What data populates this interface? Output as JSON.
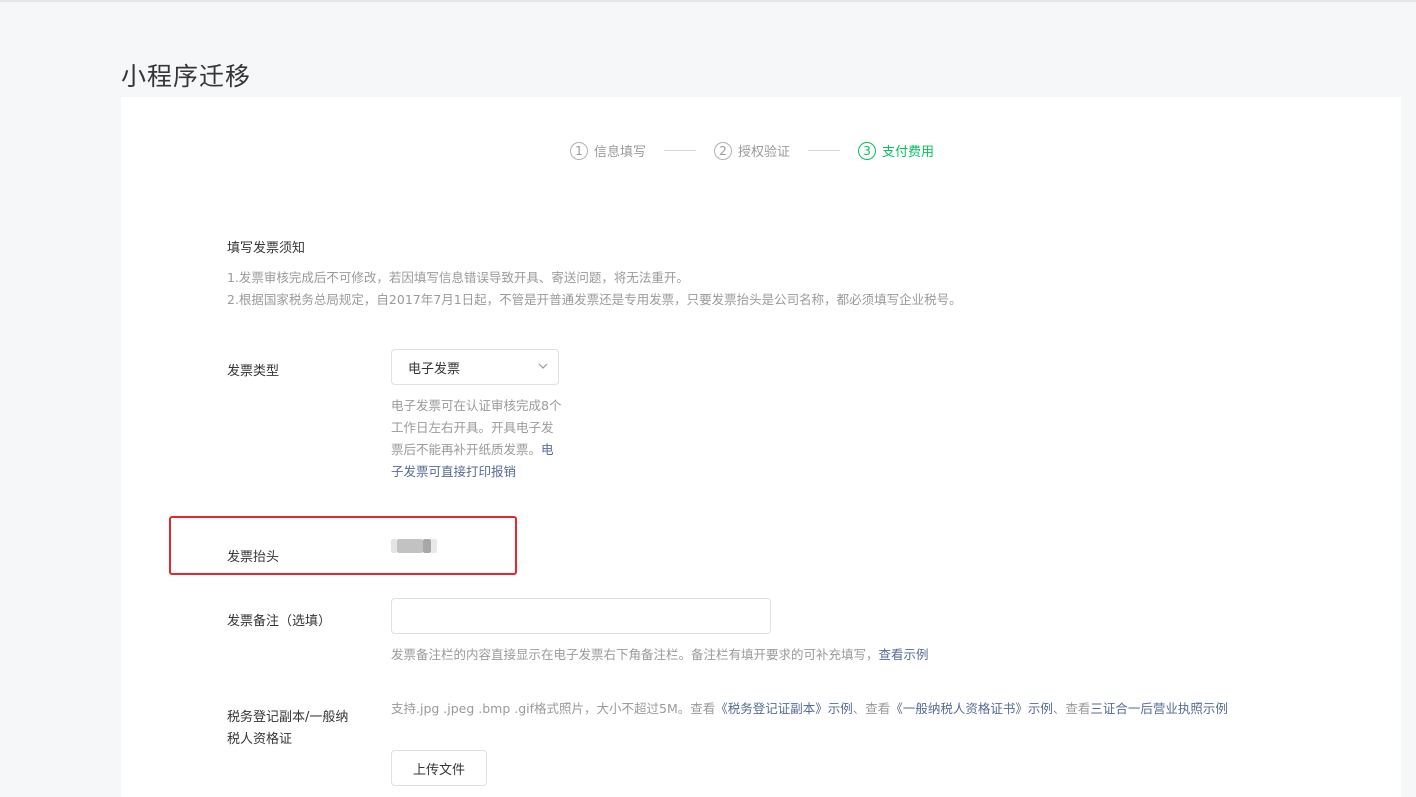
{
  "page": {
    "title": "小程序迁移"
  },
  "steps": [
    {
      "num": "1",
      "label": "信息填写",
      "active": false
    },
    {
      "num": "2",
      "label": "授权验证",
      "active": false
    },
    {
      "num": "3",
      "label": "支付费用",
      "active": true
    }
  ],
  "notice": {
    "title": "填写发票须知",
    "line1": "1.发票审核完成后不可修改，若因填写信息错误导致开具、寄送问题，将无法重开。",
    "line2": "2.根据国家税务总局规定，自2017年7月1日起，不管是开普通发票还是专用发票，只要发票抬头是公司名称，都必须填写企业税号。"
  },
  "invoice_type": {
    "label": "发票类型",
    "selected": "电子发票",
    "hint_text": "电子发票可在认证审核完成8个工作日左右开具。开具电子发票后不能再补开纸质发票。",
    "hint_link": "电子发票可直接打印报销"
  },
  "invoice_header": {
    "label": "发票抬头"
  },
  "invoice_remark": {
    "label": "发票备注（选填）",
    "value": "",
    "hint_text": "发票备注栏的内容直接显示在电子发票右下角备注栏。备注栏有填开要求的可补充填写，",
    "hint_link": "查看示例"
  },
  "tax_cert": {
    "label_line1": "税务登记副本/一般纳",
    "label_line2": "税人资格证",
    "hint_prefix": "支持.jpg .jpeg .bmp .gif格式照片，大小不超过5M。查看",
    "link1": "《税务登记证副本》示例",
    "sep1": "、查看",
    "link2": "《一般纳税人资格证书》示例",
    "sep2": "、查看",
    "link3": "三证合一后营业执照示例",
    "upload_label": "上传文件"
  },
  "colors": {
    "accent": "#07c160",
    "link": "#576b95",
    "highlight": "#e8242f"
  }
}
